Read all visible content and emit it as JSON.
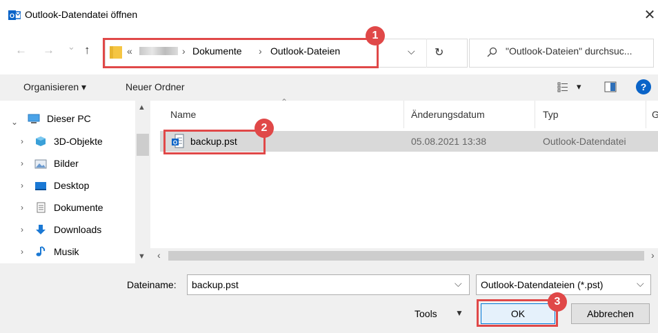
{
  "window": {
    "title": "Outlook-Datendatei öffnen",
    "close_glyph": "✕"
  },
  "nav": {
    "back": "←",
    "forward": "→",
    "recent": "⌄",
    "up": "↑",
    "breadcrumb": {
      "overflow": "«",
      "sep": "›",
      "items": [
        "Dokumente",
        "Outlook-Dateien"
      ]
    },
    "dropdown": "⌵",
    "refresh": "↻",
    "search_placeholder": "\"Outlook-Dateien\" durchsuc..."
  },
  "toolbar": {
    "organize": "Organisieren ▾",
    "new_folder": "Neuer Ordner",
    "view_caret": "▾",
    "help": "?"
  },
  "tree": {
    "items": [
      {
        "label": "Dieser PC",
        "expanded": true
      },
      {
        "label": "3D-Objekte"
      },
      {
        "label": "Bilder"
      },
      {
        "label": "Desktop"
      },
      {
        "label": "Dokumente"
      },
      {
        "label": "Downloads"
      },
      {
        "label": "Musik"
      }
    ]
  },
  "files": {
    "columns": [
      "Name",
      "Änderungsdatum",
      "Typ",
      "G"
    ],
    "rows": [
      {
        "name": "backup.pst",
        "date": "05.08.2021 13:38",
        "type": "Outlook-Datendatei"
      }
    ]
  },
  "bottom": {
    "filename_label": "Dateiname:",
    "filename_value": "backup.pst",
    "filetype": "Outlook-Datendateien (*.pst)",
    "tools": "Tools",
    "ok": "OK",
    "cancel": "Abbrechen"
  },
  "annotations": [
    "1",
    "2",
    "3"
  ],
  "colors": {
    "highlight": "#e04848",
    "folder": "#f5c542",
    "outlook_blue": "#0a64c8"
  }
}
